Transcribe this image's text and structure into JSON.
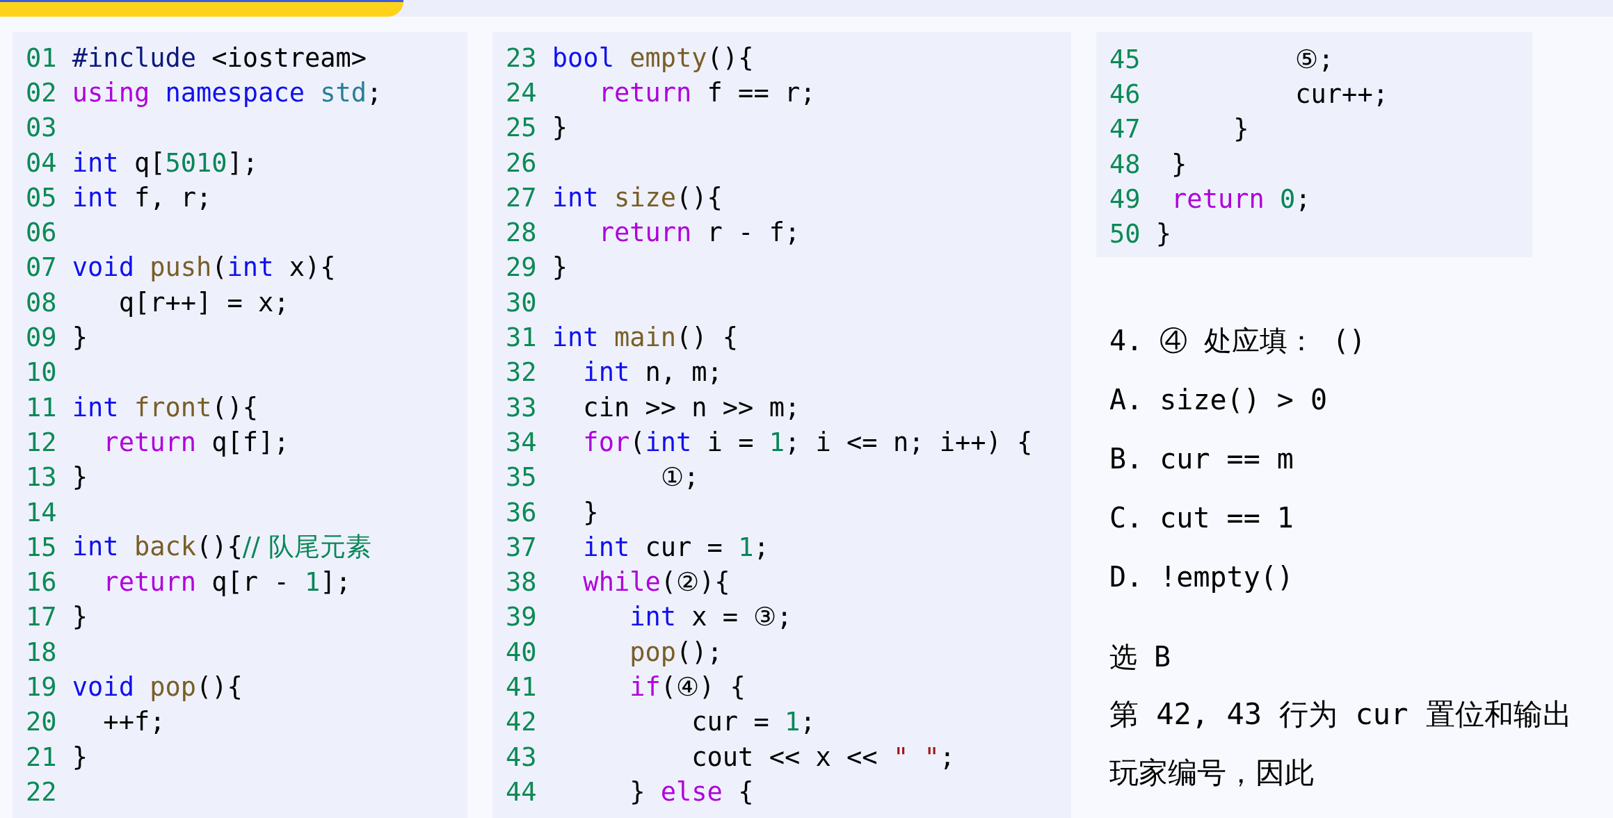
{
  "code_panels": [
    {
      "lines": [
        {
          "number": "01",
          "tokens": [
            {
              "kind": "preproc",
              "text": "#include"
            },
            {
              "kind": "plain",
              "text": " <iostream>"
            }
          ]
        },
        {
          "number": "02",
          "tokens": [
            {
              "kind": "control",
              "text": "using"
            },
            {
              "kind": "keyword",
              "text": " namespace"
            },
            {
              "kind": "namespace",
              "text": " std"
            },
            {
              "kind": "plain",
              "text": ";"
            }
          ]
        },
        {
          "number": "03"
        },
        {
          "number": "04",
          "tokens": [
            {
              "kind": "keyword",
              "text": "int"
            },
            {
              "kind": "plain",
              "text": " q["
            },
            {
              "kind": "number",
              "text": "5010"
            },
            {
              "kind": "plain",
              "text": "];"
            }
          ]
        },
        {
          "number": "05",
          "tokens": [
            {
              "kind": "keyword",
              "text": "int"
            },
            {
              "kind": "plain",
              "text": " f, r;"
            }
          ]
        },
        {
          "number": "06"
        },
        {
          "number": "07",
          "tokens": [
            {
              "kind": "keyword",
              "text": "void"
            },
            {
              "kind": "function",
              "text": " push"
            },
            {
              "kind": "plain",
              "text": "("
            },
            {
              "kind": "keyword",
              "text": "int"
            },
            {
              "kind": "plain",
              "text": " x){"
            }
          ]
        },
        {
          "number": "08",
          "tokens": [
            {
              "kind": "plain",
              "text": "   q[r++] = x;"
            }
          ]
        },
        {
          "number": "09",
          "tokens": [
            {
              "kind": "plain",
              "text": "}"
            }
          ]
        },
        {
          "number": "10"
        },
        {
          "number": "11",
          "tokens": [
            {
              "kind": "keyword",
              "text": "int"
            },
            {
              "kind": "function",
              "text": " front"
            },
            {
              "kind": "plain",
              "text": "(){"
            }
          ]
        },
        {
          "number": "12",
          "tokens": [
            {
              "kind": "control",
              "text": "  return"
            },
            {
              "kind": "plain",
              "text": " q[f];"
            }
          ]
        },
        {
          "number": "13",
          "tokens": [
            {
              "kind": "plain",
              "text": "}"
            }
          ]
        },
        {
          "number": "14"
        },
        {
          "number": "15",
          "tokens": [
            {
              "kind": "keyword",
              "text": "int"
            },
            {
              "kind": "function",
              "text": " back"
            },
            {
              "kind": "plain",
              "text": "(){"
            },
            {
              "kind": "comment",
              "text": "// 队尾元素"
            }
          ]
        },
        {
          "number": "16",
          "tokens": [
            {
              "kind": "control",
              "text": "  return"
            },
            {
              "kind": "plain",
              "text": " q[r - "
            },
            {
              "kind": "number",
              "text": "1"
            },
            {
              "kind": "plain",
              "text": "];"
            }
          ]
        },
        {
          "number": "17",
          "tokens": [
            {
              "kind": "plain",
              "text": "}"
            }
          ]
        },
        {
          "number": "18"
        },
        {
          "number": "19",
          "tokens": [
            {
              "kind": "keyword",
              "text": "void"
            },
            {
              "kind": "function",
              "text": " pop"
            },
            {
              "kind": "plain",
              "text": "(){"
            }
          ]
        },
        {
          "number": "20",
          "tokens": [
            {
              "kind": "plain",
              "text": "  ++f;"
            }
          ]
        },
        {
          "number": "21",
          "tokens": [
            {
              "kind": "plain",
              "text": "}"
            }
          ]
        },
        {
          "number": "22"
        }
      ]
    },
    {
      "lines": [
        {
          "number": "23",
          "tokens": [
            {
              "kind": "keyword",
              "text": "bool"
            },
            {
              "kind": "function",
              "text": " empty"
            },
            {
              "kind": "plain",
              "text": "(){"
            }
          ]
        },
        {
          "number": "24",
          "tokens": [
            {
              "kind": "control",
              "text": "   return"
            },
            {
              "kind": "plain",
              "text": " f == r;"
            }
          ]
        },
        {
          "number": "25",
          "tokens": [
            {
              "kind": "plain",
              "text": "}"
            }
          ]
        },
        {
          "number": "26"
        },
        {
          "number": "27",
          "tokens": [
            {
              "kind": "keyword",
              "text": "int"
            },
            {
              "kind": "function",
              "text": " size"
            },
            {
              "kind": "plain",
              "text": "(){"
            }
          ]
        },
        {
          "number": "28",
          "tokens": [
            {
              "kind": "control",
              "text": "   return"
            },
            {
              "kind": "plain",
              "text": " r - f;"
            }
          ]
        },
        {
          "number": "29",
          "tokens": [
            {
              "kind": "plain",
              "text": "}"
            }
          ]
        },
        {
          "number": "30"
        },
        {
          "number": "31",
          "tokens": [
            {
              "kind": "keyword",
              "text": "int"
            },
            {
              "kind": "function",
              "text": " main"
            },
            {
              "kind": "plain",
              "text": "() {"
            }
          ]
        },
        {
          "number": "32",
          "tokens": [
            {
              "kind": "keyword",
              "text": "  int"
            },
            {
              "kind": "plain",
              "text": " n, m;"
            }
          ]
        },
        {
          "number": "33",
          "tokens": [
            {
              "kind": "plain",
              "text": "  cin >> n >> m;"
            }
          ]
        },
        {
          "number": "34",
          "tokens": [
            {
              "kind": "control",
              "text": "  for"
            },
            {
              "kind": "plain",
              "text": "("
            },
            {
              "kind": "keyword",
              "text": "int"
            },
            {
              "kind": "plain",
              "text": " i = "
            },
            {
              "kind": "number",
              "text": "1"
            },
            {
              "kind": "plain",
              "text": "; i <= n; i++) {"
            }
          ]
        },
        {
          "number": "35",
          "tokens": [
            {
              "kind": "plain",
              "text": "       ①;"
            }
          ]
        },
        {
          "number": "36",
          "tokens": [
            {
              "kind": "plain",
              "text": "  }"
            }
          ]
        },
        {
          "number": "37",
          "tokens": [
            {
              "kind": "keyword",
              "text": "  int"
            },
            {
              "kind": "plain",
              "text": " cur = "
            },
            {
              "kind": "number",
              "text": "1"
            },
            {
              "kind": "plain",
              "text": ";"
            }
          ]
        },
        {
          "number": "38",
          "tokens": [
            {
              "kind": "control",
              "text": "  while"
            },
            {
              "kind": "plain",
              "text": "(②){"
            }
          ]
        },
        {
          "number": "39",
          "tokens": [
            {
              "kind": "keyword",
              "text": "     int"
            },
            {
              "kind": "plain",
              "text": " x = ③;"
            }
          ]
        },
        {
          "number": "40",
          "tokens": [
            {
              "kind": "function",
              "text": "     pop"
            },
            {
              "kind": "plain",
              "text": "();"
            }
          ]
        },
        {
          "number": "41",
          "tokens": [
            {
              "kind": "control",
              "text": "     if"
            },
            {
              "kind": "plain",
              "text": "(④) {"
            }
          ]
        },
        {
          "number": "42",
          "tokens": [
            {
              "kind": "plain",
              "text": "         cur = "
            },
            {
              "kind": "number",
              "text": "1"
            },
            {
              "kind": "plain",
              "text": ";"
            }
          ]
        },
        {
          "number": "43",
          "tokens": [
            {
              "kind": "plain",
              "text": "         cout << x << "
            },
            {
              "kind": "string",
              "text": "\" \""
            },
            {
              "kind": "plain",
              "text": ";"
            }
          ]
        },
        {
          "number": "44",
          "tokens": [
            {
              "kind": "plain",
              "text": "     }"
            },
            {
              "kind": "control",
              "text": " else"
            },
            {
              "kind": "plain",
              "text": " {"
            }
          ]
        }
      ]
    },
    {
      "lines": [
        {
          "number": "45",
          "tokens": [
            {
              "kind": "plain",
              "text": "         ⑤;"
            }
          ]
        },
        {
          "number": "46",
          "tokens": [
            {
              "kind": "plain",
              "text": "         cur++;"
            }
          ]
        },
        {
          "number": "47",
          "tokens": [
            {
              "kind": "plain",
              "text": "     }"
            }
          ]
        },
        {
          "number": "48",
          "tokens": [
            {
              "kind": "plain",
              "text": " }"
            }
          ]
        },
        {
          "number": "49",
          "tokens": [
            {
              "kind": "control",
              "text": " return"
            },
            {
              "kind": "number",
              "text": " 0"
            },
            {
              "kind": "plain",
              "text": ";"
            }
          ]
        },
        {
          "number": "50",
          "tokens": [
            {
              "kind": "plain",
              "text": "}"
            }
          ]
        }
      ]
    }
  ],
  "question": {
    "prompt": "4. ④ 处应填： ()",
    "options": [
      "A. size() > 0",
      "B. cur == m",
      "C. cut == 1",
      "D. !empty()"
    ],
    "answer": "选 B",
    "explanation": "第 42, 43 行为 cur 置位和输出玩家编号，因此"
  }
}
